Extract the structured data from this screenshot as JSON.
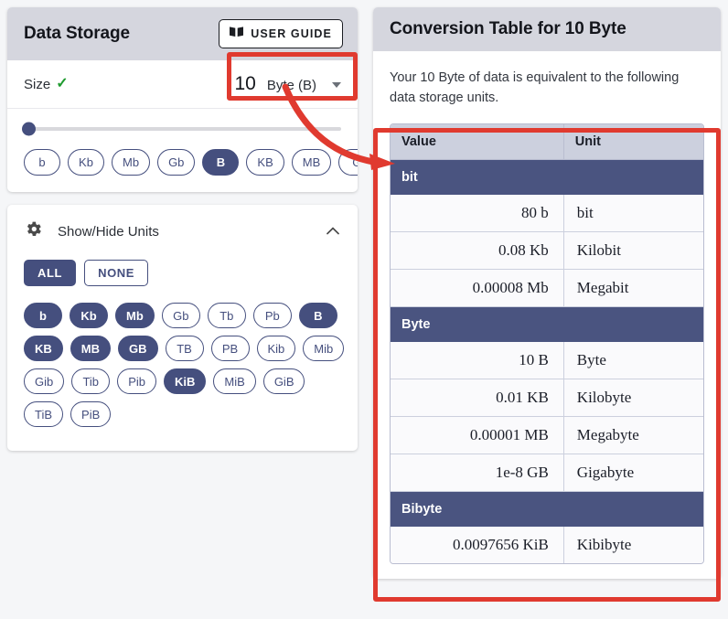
{
  "colors": {
    "accent_navy": "#454f7e",
    "table_group": "#4a5480",
    "table_header": "#ccd0de",
    "card_header": "#d5d6de",
    "annotation_red": "#e03a2f",
    "check_green": "#1f9b2f",
    "page_bg": "#f5f6f8"
  },
  "left": {
    "title": "Data Storage",
    "user_guide": {
      "label": "USER GUIDE",
      "icon": "book-icon"
    },
    "size_row": {
      "label": "Size",
      "check": "✓",
      "value": "10",
      "unit": "Byte (B)",
      "caret_icon": "chevron-down-icon"
    },
    "slider": {
      "position_percent": 0,
      "min_label": "",
      "max_label": ""
    },
    "quick_chips": [
      {
        "label": "b",
        "selected": false
      },
      {
        "label": "Kb",
        "selected": false
      },
      {
        "label": "Mb",
        "selected": false
      },
      {
        "label": "Gb",
        "selected": false
      },
      {
        "label": "B",
        "selected": true
      },
      {
        "label": "KB",
        "selected": false
      },
      {
        "label": "MB",
        "selected": false
      },
      {
        "label": "G",
        "selected": false
      }
    ],
    "units_panel": {
      "icon": "gear-icon",
      "title": "Show/Hide Units",
      "collapse_icon": "chevron-up-icon",
      "all_label": "ALL",
      "none_label": "NONE",
      "all_selected": true,
      "none_selected": false,
      "rows": [
        [
          {
            "label": "b",
            "selected": true
          },
          {
            "label": "Kb",
            "selected": true
          },
          {
            "label": "Mb",
            "selected": true
          },
          {
            "label": "Gb",
            "selected": false
          },
          {
            "label": "Tb",
            "selected": false
          },
          {
            "label": "Pb",
            "selected": false
          },
          {
            "label": "B",
            "selected": true
          }
        ],
        [
          {
            "label": "KB",
            "selected": true
          },
          {
            "label": "MB",
            "selected": true
          },
          {
            "label": "GB",
            "selected": true
          },
          {
            "label": "TB",
            "selected": false
          },
          {
            "label": "PB",
            "selected": false
          },
          {
            "label": "Kib",
            "selected": false
          },
          {
            "label": "Mib",
            "selected": false
          }
        ],
        [
          {
            "label": "Gib",
            "selected": false
          },
          {
            "label": "Tib",
            "selected": false
          },
          {
            "label": "Pib",
            "selected": false
          },
          {
            "label": "KiB",
            "selected": true
          },
          {
            "label": "MiB",
            "selected": false
          },
          {
            "label": "GiB",
            "selected": false
          }
        ],
        [
          {
            "label": "TiB",
            "selected": false
          },
          {
            "label": "PiB",
            "selected": false
          }
        ]
      ]
    }
  },
  "right": {
    "title": "Conversion Table for 10 Byte",
    "description": "Your 10 Byte of data is equivalent to the following data storage units.",
    "table": {
      "headers": [
        "Value",
        "Unit"
      ],
      "sections": [
        {
          "name": "bit",
          "rows": [
            {
              "value": "80 b",
              "unit": "bit"
            },
            {
              "value": "0.08 Kb",
              "unit": "Kilobit"
            },
            {
              "value": "0.00008 Mb",
              "unit": "Megabit"
            }
          ]
        },
        {
          "name": "Byte",
          "rows": [
            {
              "value": "10 B",
              "unit": "Byte"
            },
            {
              "value": "0.01 KB",
              "unit": "Kilobyte"
            },
            {
              "value": "0.00001 MB",
              "unit": "Megabyte"
            },
            {
              "value": "1e-8 GB",
              "unit": "Gigabyte"
            }
          ]
        },
        {
          "name": "Bibyte",
          "rows": [
            {
              "value": "0.0097656 KiB",
              "unit": "Kibibyte"
            }
          ]
        }
      ]
    }
  }
}
